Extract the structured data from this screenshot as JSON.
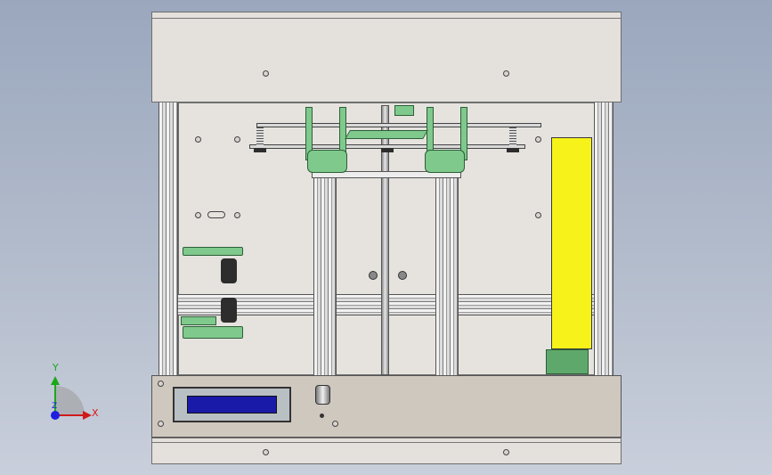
{
  "viewport": {
    "triad": {
      "x_label": "X",
      "y_label": "Y",
      "z_label": "Z"
    }
  },
  "colors": {
    "background_top": "#9aa7bd",
    "panel": "#e4e0dc",
    "control_panel": "#cfc8bf",
    "lcd_screen": "#1a1aa8",
    "power_supply": "#f7f21a",
    "parts_green": "#7fc98d",
    "axis_x": "#d11a1a",
    "axis_y": "#19a819",
    "axis_z": "#1e1ee0"
  }
}
